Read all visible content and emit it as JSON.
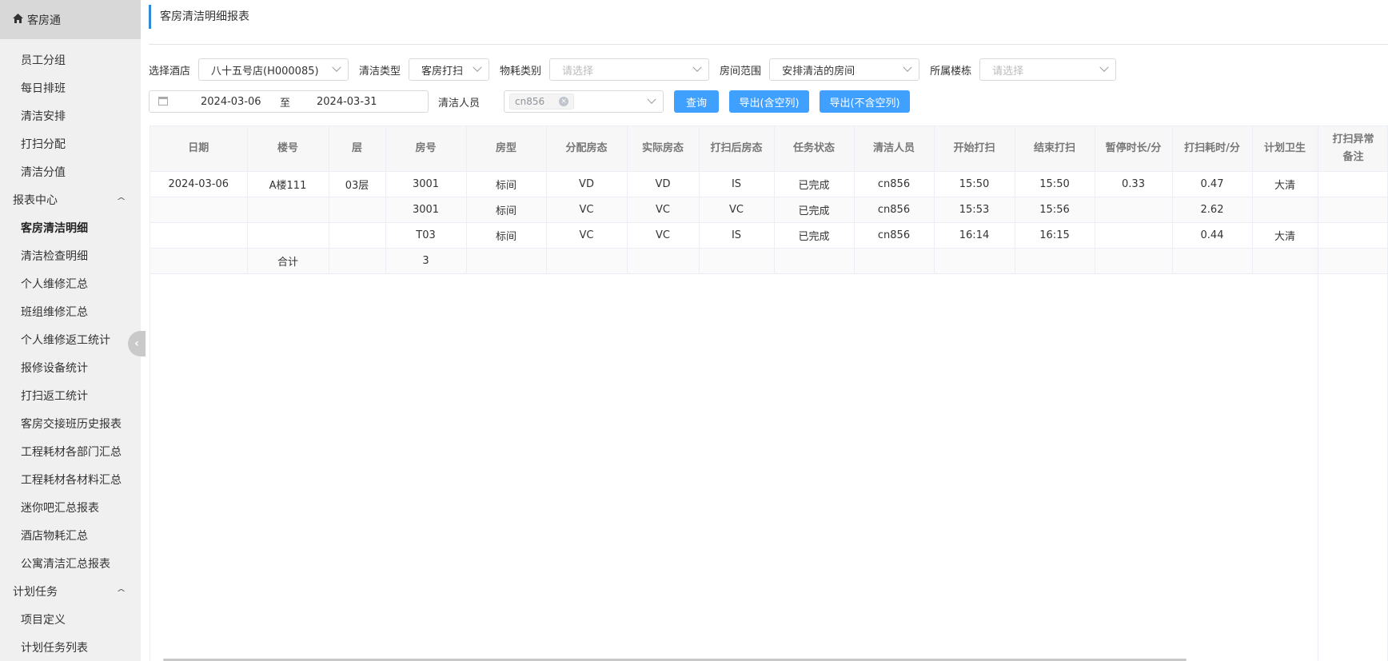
{
  "sidebar": {
    "header_icon": "home-icon",
    "header_title": "客房通",
    "items": [
      {
        "label": "员工分组",
        "type": "item"
      },
      {
        "label": "每日排班",
        "type": "item"
      },
      {
        "label": "清洁安排",
        "type": "item"
      },
      {
        "label": "打扫分配",
        "type": "item"
      },
      {
        "label": "清洁分值",
        "type": "item"
      },
      {
        "label": "报表中心",
        "type": "group"
      },
      {
        "label": "客房清洁明细",
        "type": "item",
        "active": true
      },
      {
        "label": "清洁检查明细",
        "type": "item"
      },
      {
        "label": "个人维修汇总",
        "type": "item"
      },
      {
        "label": "班组维修汇总",
        "type": "item"
      },
      {
        "label": "个人维修返工统计",
        "type": "item"
      },
      {
        "label": "报修设备统计",
        "type": "item"
      },
      {
        "label": "打扫返工统计",
        "type": "item"
      },
      {
        "label": "客房交接班历史报表",
        "type": "item"
      },
      {
        "label": "工程耗材各部门汇总",
        "type": "item"
      },
      {
        "label": "工程耗材各材料汇总",
        "type": "item"
      },
      {
        "label": "迷你吧汇总报表",
        "type": "item"
      },
      {
        "label": "酒店物耗汇总",
        "type": "item"
      },
      {
        "label": "公寓清洁汇总报表",
        "type": "item"
      },
      {
        "label": "计划任务",
        "type": "group"
      },
      {
        "label": "项目定义",
        "type": "item"
      },
      {
        "label": "计划任务列表",
        "type": "item"
      }
    ]
  },
  "page": {
    "title": "客房清洁明细报表"
  },
  "filters": {
    "hotel_label": "选择酒店",
    "hotel_value": "八十五号店(H000085)",
    "clean_type_label": "清洁类型",
    "clean_type_value": "客房打扫",
    "material_label": "物耗类别",
    "material_placeholder": "请选择",
    "room_range_label": "房间范围",
    "room_range_value": "安排清洁的房间",
    "building_label": "所属楼栋",
    "building_placeholder": "请选择",
    "date_start": "2024-03-06",
    "date_sep": "至",
    "date_end": "2024-03-31",
    "cleaner_label": "清洁人员",
    "cleaner_tag": "cn856"
  },
  "buttons": {
    "query": "查询",
    "export_with_empty": "导出(含空列)",
    "export_without_empty": "导出(不含空列)"
  },
  "table": {
    "headers": [
      "日期",
      "楼号",
      "层",
      "房号",
      "房型",
      "分配房态",
      "实际房态",
      "打扫后房态",
      "任务状态",
      "清洁人员",
      "开始打扫",
      "结束打扫",
      "暂停时长/分",
      "打扫耗时/分",
      "计划卫生",
      "打扫异常备注"
    ],
    "rows": [
      [
        "2024-03-06",
        "A楼111",
        "03层",
        "3001",
        "标间",
        "VD",
        "VD",
        "IS",
        "已完成",
        "cn856",
        "15:50",
        "15:50",
        "0.33",
        "0.47",
        "大清",
        ""
      ],
      [
        "",
        "",
        "",
        "3001",
        "标间",
        "VC",
        "VC",
        "VC",
        "已完成",
        "cn856",
        "15:53",
        "15:56",
        "",
        "2.62",
        "",
        ""
      ],
      [
        "",
        "",
        "",
        "T03",
        "标间",
        "VC",
        "VC",
        "IS",
        "已完成",
        "cn856",
        "16:14",
        "16:15",
        "",
        "0.44",
        "大清",
        ""
      ],
      [
        "",
        "合计",
        "",
        "3",
        "",
        "",
        "",
        "",
        "",
        "",
        "",
        "",
        "",
        "",
        "",
        ""
      ]
    ]
  }
}
